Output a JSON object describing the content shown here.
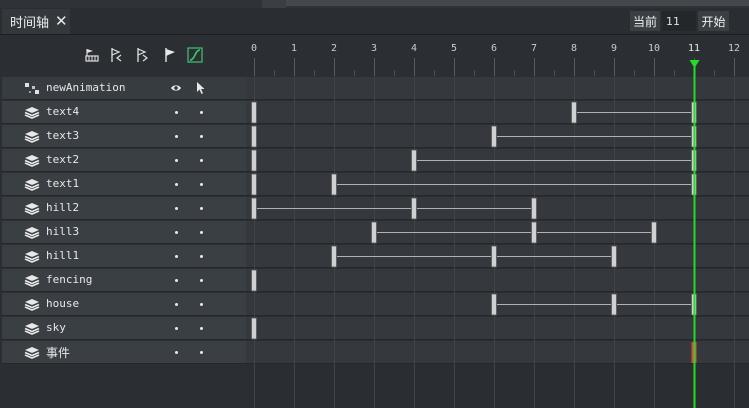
{
  "panel": {
    "tab_label": "时间轴",
    "close_glyph": "✕",
    "current_label": "当前",
    "current_value": "11",
    "start_label": "开始"
  },
  "toolbar": [
    {
      "name": "key-frame-icon"
    },
    {
      "name": "previous-frame-icon"
    },
    {
      "name": "next-frame-icon"
    },
    {
      "name": "flag-icon"
    },
    {
      "name": "curve-icon"
    }
  ],
  "ruler": {
    "ticks": [
      "0",
      "1",
      "2",
      "3",
      "4",
      "5",
      "6",
      "7",
      "8",
      "9",
      "10",
      "11",
      "12"
    ],
    "current_frame": 11
  },
  "root_row": {
    "name": "newAnimation"
  },
  "layers": [
    {
      "name": "text4",
      "keys": [
        0,
        8,
        11
      ],
      "spans": [
        [
          8,
          11
        ]
      ]
    },
    {
      "name": "text3",
      "keys": [
        0,
        6,
        11
      ],
      "spans": [
        [
          6,
          11
        ]
      ]
    },
    {
      "name": "text2",
      "keys": [
        0,
        4,
        11
      ],
      "spans": [
        [
          4,
          11
        ]
      ]
    },
    {
      "name": "text1",
      "keys": [
        0,
        2,
        11
      ],
      "spans": [
        [
          2,
          11
        ]
      ]
    },
    {
      "name": "hill2",
      "keys": [
        0,
        4,
        7
      ],
      "spans": [
        [
          0,
          4
        ],
        [
          4,
          7
        ]
      ]
    },
    {
      "name": "hill3",
      "keys": [
        3,
        7,
        10
      ],
      "spans": [
        [
          3,
          7
        ],
        [
          7,
          10
        ]
      ]
    },
    {
      "name": "hill1",
      "keys": [
        2,
        6,
        9
      ],
      "spans": [
        [
          2,
          6
        ],
        [
          6,
          9
        ]
      ]
    },
    {
      "name": "fencing",
      "keys": [
        0
      ],
      "spans": []
    },
    {
      "name": "house",
      "keys": [
        6,
        9,
        11
      ],
      "spans": [
        [
          6,
          9
        ],
        [
          9,
          11
        ]
      ]
    },
    {
      "name": "sky",
      "keys": [
        0
      ],
      "spans": []
    },
    {
      "name": "事件",
      "keys": [],
      "spans": [],
      "event_marker": 11
    }
  ],
  "colors": {
    "playhead": "#22dd22",
    "keyframe": "#d0d0d0",
    "span_line": "#aeb2b6",
    "event_marker": "#e04848",
    "accent_curve": "#3cc870"
  }
}
